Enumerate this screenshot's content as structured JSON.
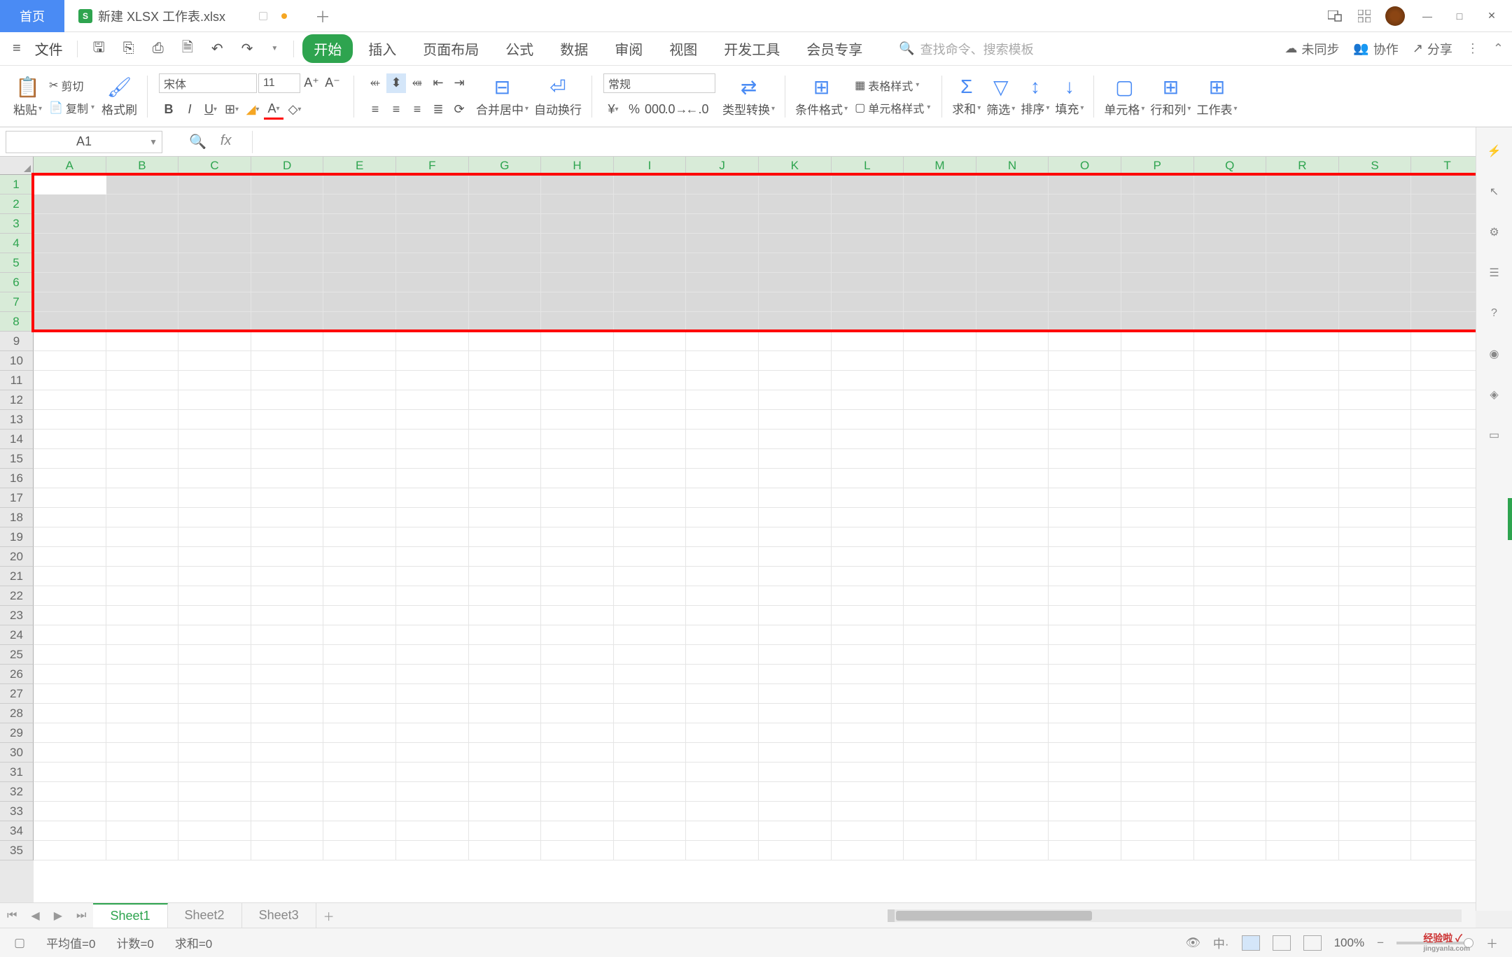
{
  "titlebar": {
    "home": "首页",
    "file_icon": "S",
    "filename": "新建 XLSX 工作表.xlsx"
  },
  "menu": {
    "file": "文件",
    "tabs": [
      "开始",
      "插入",
      "页面布局",
      "公式",
      "数据",
      "审阅",
      "视图",
      "开发工具",
      "会员专享"
    ],
    "search_placeholder": "查找命令、搜索模板",
    "unsync": "未同步",
    "collab": "协作",
    "share": "分享"
  },
  "toolbar": {
    "paste": "粘贴",
    "cut": "剪切",
    "copy": "复制",
    "format_painter": "格式刷",
    "font": "宋体",
    "font_size": "11",
    "merge": "合并居中",
    "wrap": "自动换行",
    "number_format": "常规",
    "type_convert": "类型转换",
    "cond_format": "条件格式",
    "table_style": "表格样式",
    "cell_style": "单元格样式",
    "sum": "求和",
    "filter": "筛选",
    "sort": "排序",
    "fill": "填充",
    "cell": "单元格",
    "rowcol": "行和列",
    "worksheet": "工作表"
  },
  "formulabar": {
    "namebox": "A1"
  },
  "columns": [
    "A",
    "B",
    "C",
    "D",
    "E",
    "F",
    "G",
    "H",
    "I",
    "J",
    "K",
    "L",
    "M",
    "N",
    "O",
    "P",
    "Q",
    "R",
    "S",
    "T"
  ],
  "rows": [
    "1",
    "2",
    "3",
    "4",
    "5",
    "6",
    "7",
    "8",
    "9",
    "10",
    "11",
    "12",
    "13",
    "14",
    "15",
    "16",
    "17",
    "18",
    "19",
    "20",
    "21",
    "22",
    "23",
    "24",
    "25",
    "26",
    "27",
    "28",
    "29",
    "30",
    "31",
    "32",
    "33",
    "34",
    "35"
  ],
  "selected_rows": 8,
  "sheets": [
    "Sheet1",
    "Sheet2",
    "Sheet3"
  ],
  "statusbar": {
    "avg": "平均值=0",
    "count": "计数=0",
    "sum": "求和=0",
    "zoom": "100%"
  },
  "watermark": {
    "main": "经验啦 ✓",
    "sub": "jingyanla.com"
  }
}
